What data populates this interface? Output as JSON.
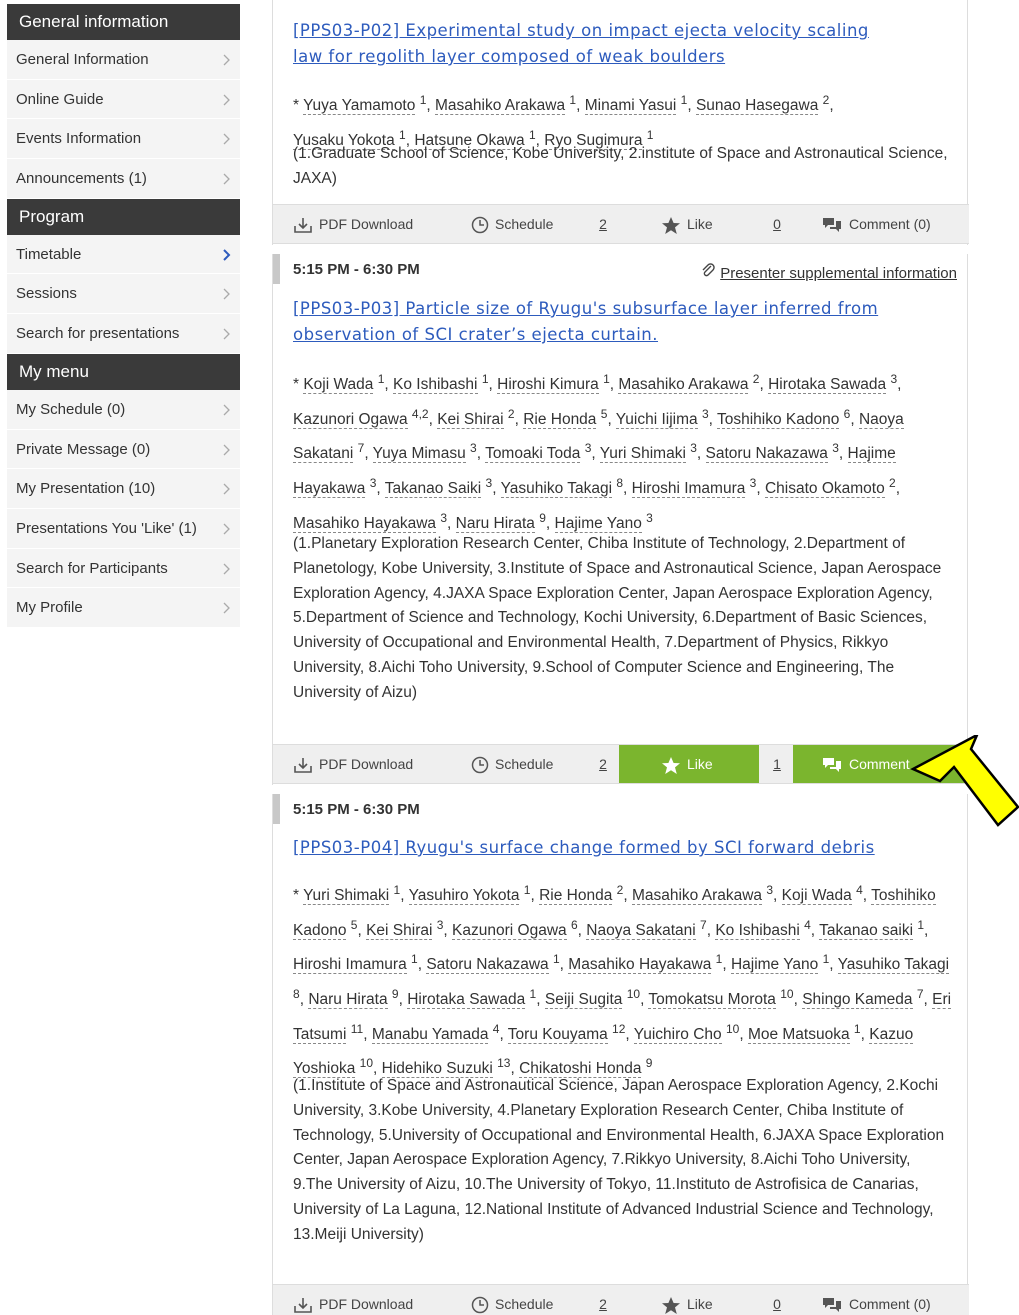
{
  "sidebar": {
    "sections": [
      {
        "heading": "General information",
        "items": [
          "General Information",
          "Online Guide",
          "Events Information",
          "Announcements (1)"
        ]
      },
      {
        "heading": "Program",
        "items": [
          "Timetable",
          "Sessions",
          "Search for presentations"
        ]
      },
      {
        "heading": "My menu",
        "items": [
          "My Schedule (0)",
          "Private Message (0)",
          "My Presentation (10)",
          "Presentations You 'Like' (1)",
          "Search for Participants",
          "My Profile"
        ]
      }
    ],
    "active_item": "Timetable",
    "colors": {
      "heading_bg": "#3a3a3a",
      "item_bg": "#f4f4f4",
      "active_chevron": "#2d5bbd"
    }
  },
  "labels": {
    "pdf": "PDF Download",
    "schedule": "Schedule",
    "like": "Like",
    "supplemental": "Presenter supplemental information"
  },
  "presentations": [
    {
      "title_line1": "[PPS03-P02] Experimental study on impact ejecta velocity scaling",
      "title_line2": "law for regolith layer composed of weak boulders",
      "authors_html": "* <span class=\"au\">Yuya Yamamoto</span> <sup>1</sup>, <span class=\"au\">Masahiko Arakawa</span> <sup>1</sup>, <span class=\"au\">Minami Yasui</span> <sup>1</sup>, <span class=\"au\">Sunao Hasegawa</span> <sup>2</sup>,<br><span class=\"au\">Yusaku Yokota</span> <sup>1</sup>, <span class=\"au\">Hatsune Okawa</span> <sup>1</sup>, <span class=\"au\">Ryo Sugimura</span> <sup>1</sup>",
      "affiliation": "(1.Graduate School of Science, Kobe University, 2.institute of Space and Astronautical Science, JAXA)",
      "schedule_count": "2",
      "like_count": "0",
      "comment": "Comment (0)"
    },
    {
      "time": "5:15 PM - 6:30 PM",
      "title_line1": "[PPS03-P03] Particle size of Ryugu's subsurface layer inferred from",
      "title_line2": "observation of SCI crater’s ejecta curtain.",
      "authors_html": "* <span class=\"au\">Koji Wada</span> <sup>1</sup>, <span class=\"au\">Ko Ishibashi</span> <sup>1</sup>, <span class=\"au\">Hiroshi Kimura</span> <sup>1</sup>, <span class=\"au\">Masahiko Arakawa</span> <sup>2</sup>, <span class=\"au\">Hirotaka Sawada</span> <sup>3</sup>, <span class=\"au\">Kazunori Ogawa</span> <sup>4,2</sup>, <span class=\"au\">Kei Shirai</span> <sup>2</sup>, <span class=\"au\">Rie Honda</span> <sup>5</sup>, <span class=\"au\">Yuichi Iijima</span> <sup>3</sup>, <span class=\"au\">Toshihiko Kadono</span> <sup>6</sup>, <span class=\"au\">Naoya Sakatani</span> <sup>7</sup>, <span class=\"au\">Yuya Mimasu</span> <sup>3</sup>, <span class=\"au\">Tomoaki Toda</span> <sup>3</sup>, <span class=\"au\">Yuri Shimaki</span> <sup>3</sup>, <span class=\"au\">Satoru Nakazawa</span> <sup>3</sup>, <span class=\"au\">Hajime Hayakawa</span> <sup>3</sup>, <span class=\"au\">Takanao Saiki</span> <sup>3</sup>, <span class=\"au\">Yasuhiko Takagi</span> <sup>8</sup>, <span class=\"au\">Hiroshi Imamura</span> <sup>3</sup>, <span class=\"au\">Chisato Okamoto</span> <sup>2</sup>, <span class=\"au\">Masahiko Hayakawa</span> <sup>3</sup>, <span class=\"au\">Naru Hirata</span> <sup>9</sup>, <span class=\"au\">Hajime Yano</span> <sup>3</sup>",
      "affiliation": "(1.Planetary Exploration Research Center, Chiba Institute of Technology, 2.Department of Planetology, Kobe University, 3.Institute of Space and Astronautical Science, Japan Aerospace Exploration Agency, 4.JAXA Space Exploration Center, Japan Aerospace Exploration Agency, 5.Department of Science and Technology, Kochi University, 6.Department of Basic Sciences, University of Occupational and Environmental Health, 7.Department of Physics, Rikkyo University, 8.Aichi Toho University, 9.School of Computer Science and Engineering, The University of Aizu)",
      "schedule_count": "2",
      "like_count": "1",
      "comment": "Comment"
    },
    {
      "time": "5:15 PM - 6:30 PM",
      "title_line1": "[PPS03-P04] Ryugu's surface change formed by SCI forward debris",
      "authors_html": "* <span class=\"au\">Yuri Shimaki</span> <sup>1</sup>, <span class=\"au\">Yasuhiro Yokota</span> <sup>1</sup>, <span class=\"au\">Rie Honda</span> <sup>2</sup>, <span class=\"au\">Masahiko Arakawa</span> <sup>3</sup>, <span class=\"au\">Koji Wada</span> <sup>4</sup>, <span class=\"au\">Toshihiko Kadono</span> <sup>5</sup>, <span class=\"au\">Kei Shirai</span> <sup>3</sup>, <span class=\"au\">Kazunori Ogawa</span> <sup>6</sup>, <span class=\"au\">Naoya Sakatani</span> <sup>7</sup>, <span class=\"au\">Ko Ishibashi</span> <sup>4</sup>, <span class=\"au\">Takanao saiki</span> <sup>1</sup>, <span class=\"au\">Hiroshi Imamura</span> <sup>1</sup>, <span class=\"au\">Satoru Nakazawa</span> <sup>1</sup>, <span class=\"au\">Masahiko Hayakawa</span> <sup>1</sup>, <span class=\"au\">Hajime Yano</span> <sup>1</sup>, <span class=\"au\">Yasuhiko Takagi</span> <sup>8</sup>, <span class=\"au\">Naru Hirata</span> <sup>9</sup>, <span class=\"au\">Hirotaka Sawada</span> <sup>1</sup>, <span class=\"au\">Seiji Sugita</span> <sup>10</sup>, <span class=\"au\">Tomokatsu Morota</span> <sup>10</sup>, <span class=\"au\">Shingo Kameda</span> <sup>7</sup>, <span class=\"au\">Eri Tatsumi</span> <sup>11</sup>, <span class=\"au\">Manabu Yamada</span> <sup>4</sup>, <span class=\"au\">Toru Kouyama</span> <sup>12</sup>, <span class=\"au\">Yuichiro Cho</span> <sup>10</sup>, <span class=\"au\">Moe Matsuoka</span> <sup>1</sup>, <span class=\"au\">Kazuo Yoshioka</span> <sup>10</sup>, <span class=\"au\">Hidehiko Suzuki</span> <sup>13</sup>, <span class=\"au\">Chikatoshi Honda</span> <sup>9</sup>",
      "affiliation": "(1.Institute of Space and Astronautical Science, Japan Aerospace Exploration Agency, 2.Kochi University, 3.Kobe University, 4.Planetary Exploration Research Center, Chiba Institute of Technology, 5.University of Occupational and Environmental Health, 6.JAXA Space Exploration Center, Japan Aerospace Exploration Agency, 7.Rikkyo University, 8.Aichi Toho University, 9.The University of Aizu, 10.The University of Tokyo, 11.Instituto de Astrofisica de Canarias, University of La Laguna, 12.National Institute of Advanced Industrial Science and Technology, 13.Meiji University)",
      "schedule_count": "2",
      "like_count": "0",
      "comment": "Comment (0)"
    }
  ],
  "colors": {
    "link": "#2d5bbd",
    "like_active": "#7bb52e",
    "action_bar": "#efefef",
    "arrow": "#ffff00"
  },
  "icons": [
    "chevron-right-icon",
    "pdf-download-icon",
    "clock-icon",
    "star-icon",
    "comment-icon",
    "paperclip-icon",
    "pointer-arrow-icon"
  ]
}
